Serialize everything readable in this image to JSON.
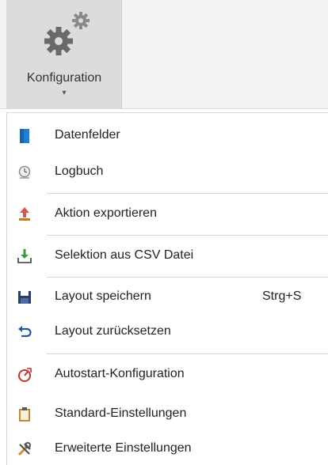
{
  "ribbon": {
    "button_label": "Konfiguration",
    "icon": "gears-icon",
    "caret": "▾"
  },
  "menu": {
    "items": [
      {
        "label": "Datenfelder",
        "icon": "database-icon"
      },
      {
        "label": "Logbuch",
        "icon": "logbook-icon"
      },
      {
        "label": "Aktion exportieren",
        "icon": "export-icon"
      },
      {
        "label": "Selektion aus CSV Datei",
        "icon": "import-icon"
      },
      {
        "label": "Layout speichern",
        "icon": "save-icon",
        "shortcut": "Strg+S"
      },
      {
        "label": "Layout zurücksetzen",
        "icon": "undo-icon"
      },
      {
        "label": "Autostart-Konfiguration",
        "icon": "autostart-icon"
      },
      {
        "label": "Standard-Einstellungen",
        "icon": "clipboard-icon"
      },
      {
        "label": "Erweiterte Einstellungen",
        "icon": "tools-icon"
      }
    ]
  },
  "colors": {
    "accent_blue": "#1e7fd6",
    "save_navy": "#2a3f6b",
    "export_red": "#d9534f",
    "import_green": "#3a9a3a"
  }
}
